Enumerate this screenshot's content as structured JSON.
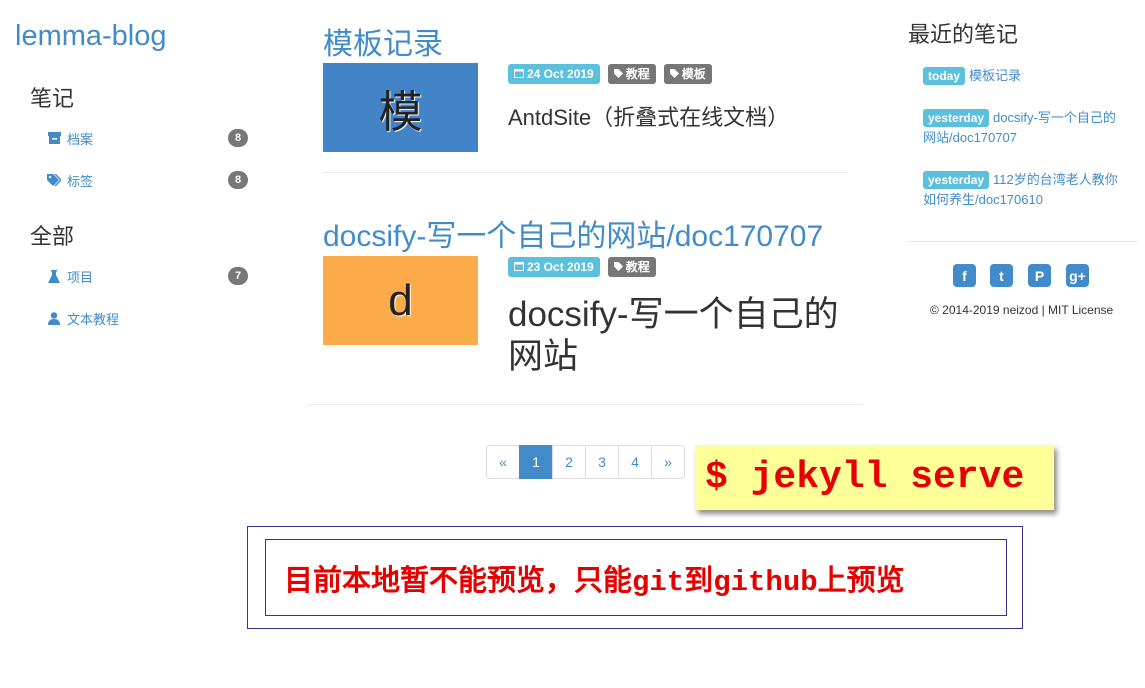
{
  "site": {
    "title": "lemma-blog"
  },
  "sidebar": {
    "sections": [
      {
        "title": "笔记",
        "items": [
          {
            "label": "档案",
            "icon": "archive-icon",
            "count": "8"
          },
          {
            "label": "标签",
            "icon": "tags-icon",
            "count": "8"
          }
        ]
      },
      {
        "title": "全部",
        "items": [
          {
            "label": "项目",
            "icon": "flask-icon",
            "count": "7"
          },
          {
            "label": "文本教程",
            "icon": "user-icon",
            "count": ""
          }
        ]
      }
    ]
  },
  "posts": [
    {
      "title": "模板记录",
      "thumb_letter": "模",
      "thumb_color": "#4383c7",
      "date": "24 Oct 2019",
      "tags": [
        "教程",
        "模板"
      ],
      "excerpt": "AntdSite（折叠式在线文档）"
    },
    {
      "title": "docsify-写一个自己的网站/doc170707",
      "thumb_letter": "d",
      "thumb_color": "#fbab4a",
      "date": "23 Oct 2019",
      "tags": [
        "教程"
      ],
      "excerpt_line1": "docsify-写一个自己的",
      "excerpt_line2": "网站"
    }
  ],
  "pagination": {
    "prev": "«",
    "pages": [
      "1",
      "2",
      "3",
      "4"
    ],
    "active": "1",
    "next": "»"
  },
  "recent": {
    "title": "最近的笔记",
    "items": [
      {
        "badge": "today",
        "text": "模板记录"
      },
      {
        "badge": "yesterday",
        "text": "docsify-写一个自己的网站/doc170707"
      },
      {
        "badge": "yesterday",
        "text": "112岁的台湾老人教你如何养生/doc170610"
      }
    ]
  },
  "social": [
    {
      "name": "facebook-icon",
      "glyph": "f"
    },
    {
      "name": "twitter-icon",
      "glyph": "t"
    },
    {
      "name": "pinterest-icon",
      "glyph": "P"
    },
    {
      "name": "google-plus-icon",
      "glyph": "g+"
    }
  ],
  "footer": {
    "copyright": "© 2014-2019 neizod | MIT License"
  },
  "annotations": {
    "command": "$ jekyll serve",
    "note": "目前本地暂不能预览，只能git到github上预览"
  },
  "colors": {
    "accent": "#428bca",
    "info": "#5bc0de",
    "label_grey": "#777777",
    "annotation_red": "#e60000",
    "note_yellow": "#ffff99"
  }
}
